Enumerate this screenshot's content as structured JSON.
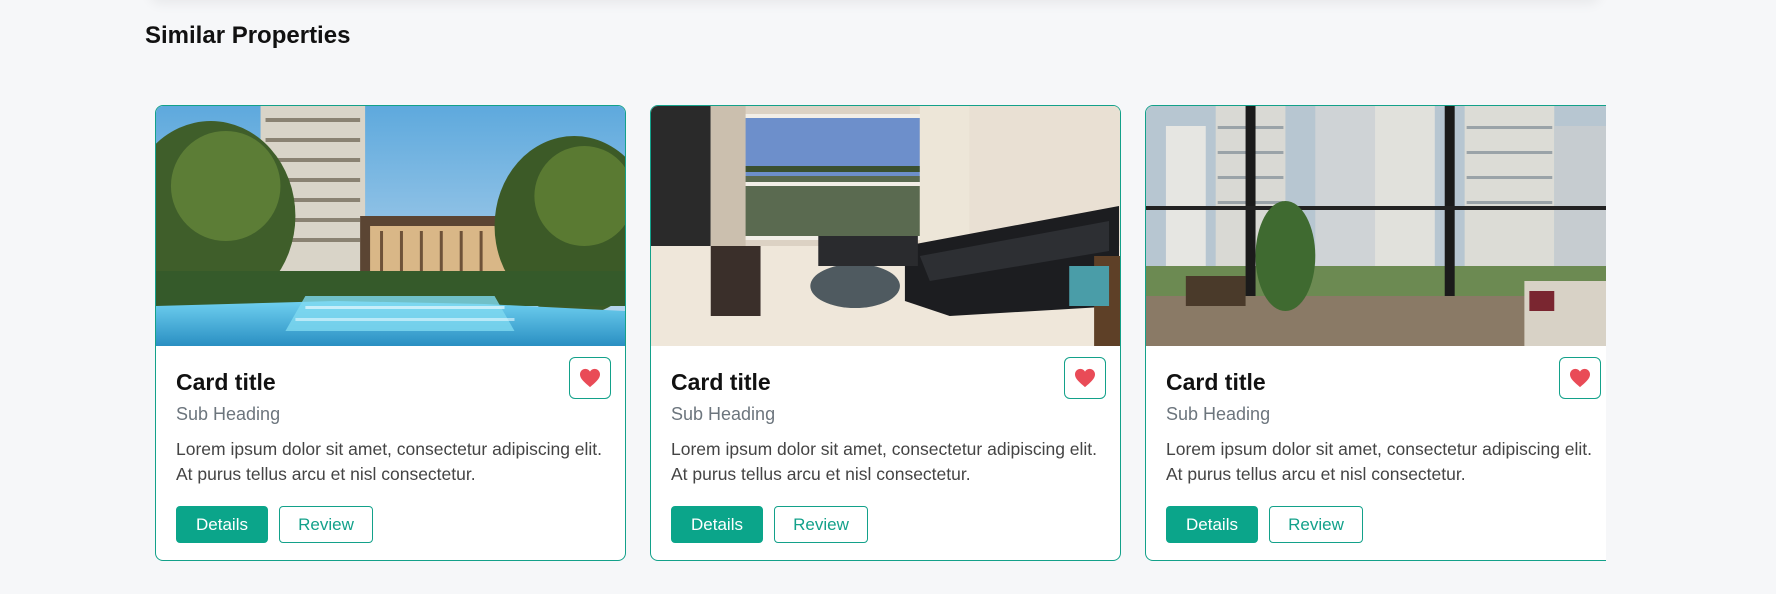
{
  "section": {
    "title": "Similar Properties"
  },
  "colors": {
    "accent": "#0ba58a",
    "heart": "#e94b57",
    "card_border": "#13a18a"
  },
  "cards": [
    {
      "title": "Card title",
      "subheading": "Sub Heading",
      "text": "Lorem ipsum dolor sit amet, consectetur adipiscing elit. At purus tellus arcu et nisl consectetur.",
      "primary_button": "Details",
      "secondary_button": "Review",
      "favorite_icon": "heart-icon",
      "image": "condo-pool-garden"
    },
    {
      "title": "Card title",
      "subheading": "Sub Heading",
      "text": "Lorem ipsum dolor sit amet, consectetur adipiscing elit. At purus tellus arcu et nisl consectetur.",
      "primary_button": "Details",
      "secondary_button": "Review",
      "favorite_icon": "heart-icon",
      "image": "living-room-leather-sofa"
    },
    {
      "title": "Card title",
      "subheading": "Sub Heading",
      "text": "Lorem ipsum dolor sit amet, consectetur adipiscing elit. At purus tellus arcu et nisl consectetur.",
      "primary_button": "Details",
      "secondary_button": "Review",
      "favorite_icon": "heart-icon",
      "image": "balcony-city-view"
    }
  ]
}
